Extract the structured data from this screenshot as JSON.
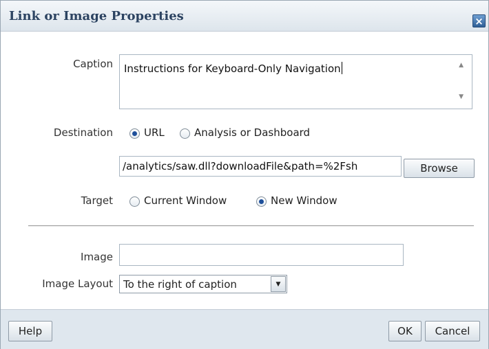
{
  "dialog": {
    "title": "Link or Image Properties",
    "close_icon": "×"
  },
  "caption": {
    "label": "Caption",
    "value": "Instructions for Keyboard-Only Navigation"
  },
  "destination": {
    "label": "Destination",
    "options": [
      {
        "label": "URL",
        "checked": true
      },
      {
        "label": "Analysis or Dashboard",
        "checked": false
      }
    ],
    "url_value": "/analytics/saw.dll?downloadFile&path=%2Fsh",
    "browse_label": "Browse"
  },
  "target": {
    "label": "Target",
    "options": [
      {
        "label": "Current Window",
        "checked": false
      },
      {
        "label": "New Window",
        "checked": true
      }
    ]
  },
  "image": {
    "label": "Image",
    "value": ""
  },
  "image_layout": {
    "label": "Image Layout",
    "selected": "To the right of caption"
  },
  "footer": {
    "help_label": "Help",
    "ok_label": "OK",
    "cancel_label": "Cancel"
  },
  "colors": {
    "title_text": "#2c4361",
    "footer_bg": "#dfe7ee",
    "radio_dot": "#1e4f9a"
  }
}
